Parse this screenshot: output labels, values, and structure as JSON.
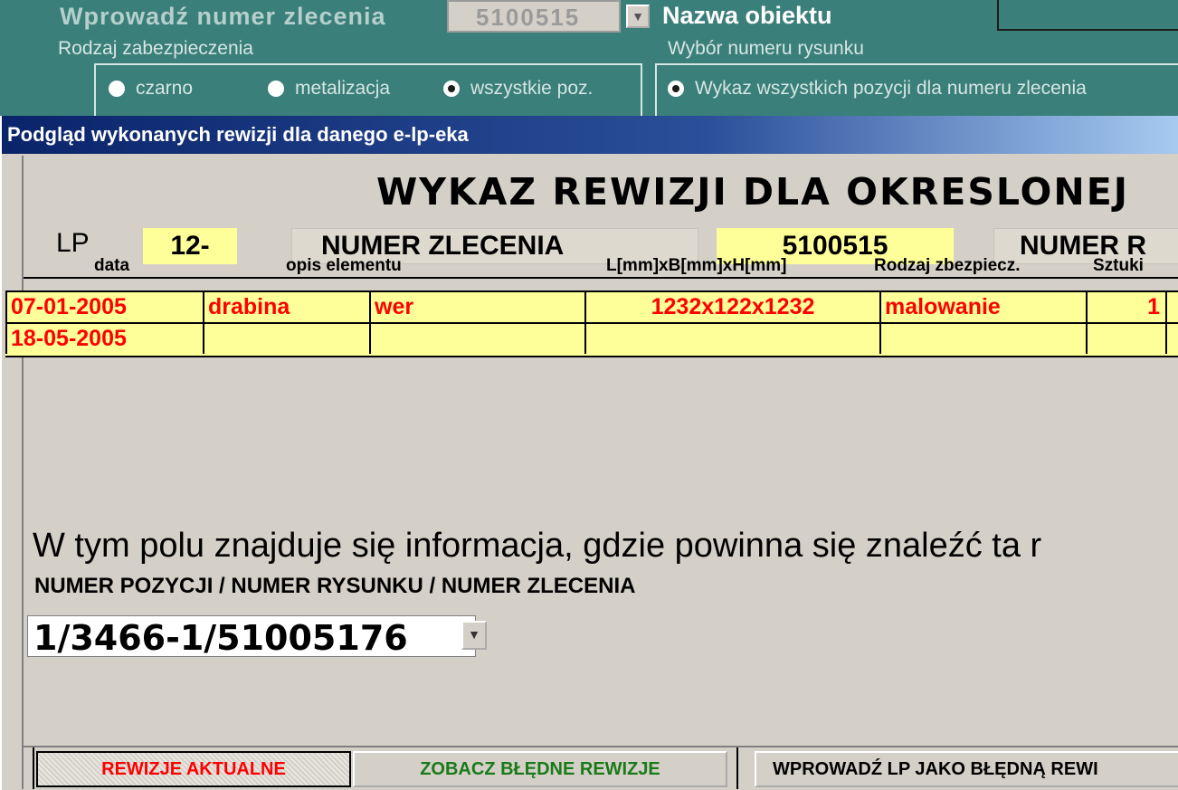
{
  "background_form": {
    "order_label": "Wprowadź numer zlecenia",
    "order_value": "5100515",
    "object_label": "Nazwa obiektu",
    "protection_label": "Rodzaj zabezpieczenia",
    "drawing_choice_label": "Wybór numeru rysunku",
    "protection_options": [
      {
        "label": "czarno",
        "checked": false
      },
      {
        "label": "metalizacja",
        "checked": false
      },
      {
        "label": "wszystkie poz.",
        "checked": true
      }
    ],
    "drawing_option": {
      "label": "Wykaz wszystkich pozycji dla numeru zlecenia",
      "checked": true
    }
  },
  "window": {
    "title": "Podgląd wykonanych rewizji dla danego e-lp-eka",
    "heading": "WYKAZ REWIZJI DLA OKRESLONEJ",
    "lp_label": "LP",
    "lp_value": "12-",
    "order_label": "NUMER ZLECENIA",
    "order_value": "5100515",
    "drawing_label": "NUMER R"
  },
  "table": {
    "columns": [
      "data",
      "opis elementu",
      "L[mm]xB[mm]xH[mm]",
      "Rodzaj zbezpiecz.",
      "Sztuki"
    ],
    "rows": [
      {
        "date": "07-01-2005",
        "element": "drabina",
        "desc": "wer",
        "dims": "1232x122x1232",
        "type": "malowanie",
        "qty": "1"
      },
      {
        "date": "18-05-2005",
        "element": "",
        "desc": "",
        "dims": "",
        "type": "",
        "qty": ""
      }
    ]
  },
  "info": {
    "text": "W tym polu znajduje się informacja, gdzie powinna się znaleźć ta r",
    "subtitle": "NUMER POZYCJI / NUMER RYSUNKU / NUMER ZLECENIA",
    "position_value": "1/3466-1/51005176"
  },
  "buttons": {
    "current": "REWIZJE AKTUALNE",
    "wrong": "ZOBACZ BŁĘDNE REWIZJE",
    "mark": "WPROWADŹ LP JAKO BŁĘDNĄ REWI"
  },
  "colors": {
    "background": "#3a7f7a",
    "window": "#d4d0c8",
    "highlight": "#ffff99",
    "row_text": "#ff0000",
    "title_bar": "#0a246a"
  }
}
